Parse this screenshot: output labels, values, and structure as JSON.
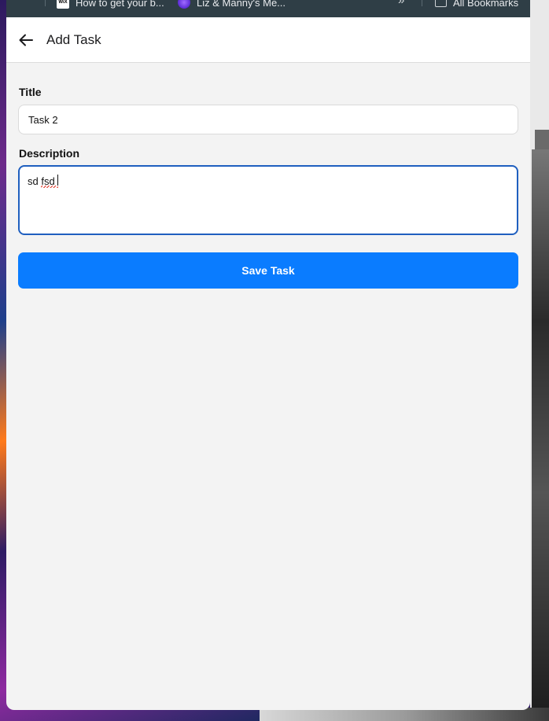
{
  "bookmarks_bar": {
    "items": [
      {
        "label": "How to get your b...",
        "icon": "wix-icon"
      },
      {
        "label": "Liz & Manny's Me...",
        "icon": "liz-icon"
      }
    ],
    "all_bookmarks_label": "All Bookmarks"
  },
  "header": {
    "title": "Add Task",
    "back_icon": "arrow-left-icon"
  },
  "form": {
    "title_label": "Title",
    "title_value": "Task 2",
    "description_label": "Description",
    "description_value": "sd fsd ",
    "save_label": "Save Task"
  },
  "colors": {
    "accent": "#0a7cff",
    "focus_border": "#1f5fbf",
    "bookmarks_bar": "#2f3e46",
    "page_bg": "#f3f3f3"
  }
}
